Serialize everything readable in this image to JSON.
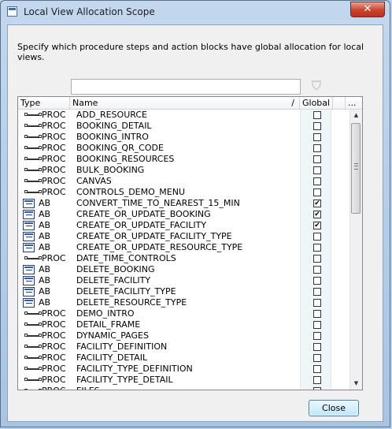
{
  "window": {
    "title": "Local View Allocation Scope",
    "close_glyph": "✕"
  },
  "instructions": "Specify which procedure steps and action blocks have global allocation for local views.",
  "search": {
    "value": "",
    "placeholder": ""
  },
  "columns": {
    "type": "Type",
    "name": "Name",
    "name_sort": "/",
    "global": "Global",
    "extra": "...",
    "filter_icon": "funnel-icon"
  },
  "rows": [
    {
      "type": "PROC",
      "name": "ADD_RESOURCE",
      "global": false
    },
    {
      "type": "PROC",
      "name": "BOOKING_DETAIL",
      "global": false
    },
    {
      "type": "PROC",
      "name": "BOOKING_INTRO",
      "global": false
    },
    {
      "type": "PROC",
      "name": "BOOKING_QR_CODE",
      "global": false
    },
    {
      "type": "PROC",
      "name": "BOOKING_RESOURCES",
      "global": false
    },
    {
      "type": "PROC",
      "name": "BULK_BOOKING",
      "global": false
    },
    {
      "type": "PROC",
      "name": "CANVAS",
      "global": false
    },
    {
      "type": "PROC",
      "name": "CONTROLS_DEMO_MENU",
      "global": false
    },
    {
      "type": "AB",
      "name": "CONVERT_TIME_TO_NEAREST_15_MIN",
      "global": true
    },
    {
      "type": "AB",
      "name": "CREATE_OR_UPDATE_BOOKING",
      "global": true
    },
    {
      "type": "AB",
      "name": "CREATE_OR_UPDATE_FACILITY",
      "global": true
    },
    {
      "type": "AB",
      "name": "CREATE_OR_UPDATE_FACILITY_TYPE",
      "global": false
    },
    {
      "type": "AB",
      "name": "CREATE_OR_UPDATE_RESOURCE_TYPE",
      "global": false
    },
    {
      "type": "PROC",
      "name": "DATE_TIME_CONTROLS",
      "global": false
    },
    {
      "type": "AB",
      "name": "DELETE_BOOKING",
      "global": false
    },
    {
      "type": "AB",
      "name": "DELETE_FACILITY",
      "global": false
    },
    {
      "type": "AB",
      "name": "DELETE_FACILITY_TYPE",
      "global": false
    },
    {
      "type": "AB",
      "name": "DELETE_RESOURCE_TYPE",
      "global": false
    },
    {
      "type": "PROC",
      "name": "DEMO_INTRO",
      "global": false
    },
    {
      "type": "PROC",
      "name": "DETAIL_FRAME",
      "global": false
    },
    {
      "type": "PROC",
      "name": "DYNAMIC_PAGES",
      "global": false
    },
    {
      "type": "PROC",
      "name": "FACILITY_DEFINITION",
      "global": false
    },
    {
      "type": "PROC",
      "name": "FACILITY_DETAIL",
      "global": false
    },
    {
      "type": "PROC",
      "name": "FACILITY_TYPE_DEFINITION",
      "global": false
    },
    {
      "type": "PROC",
      "name": "FACILITY_TYPE_DETAIL",
      "global": false
    },
    {
      "type": "PROC",
      "name": "FILES",
      "global": false
    }
  ],
  "scrollbar": {
    "position": 0.0
  },
  "buttons": {
    "close": "Close"
  }
}
